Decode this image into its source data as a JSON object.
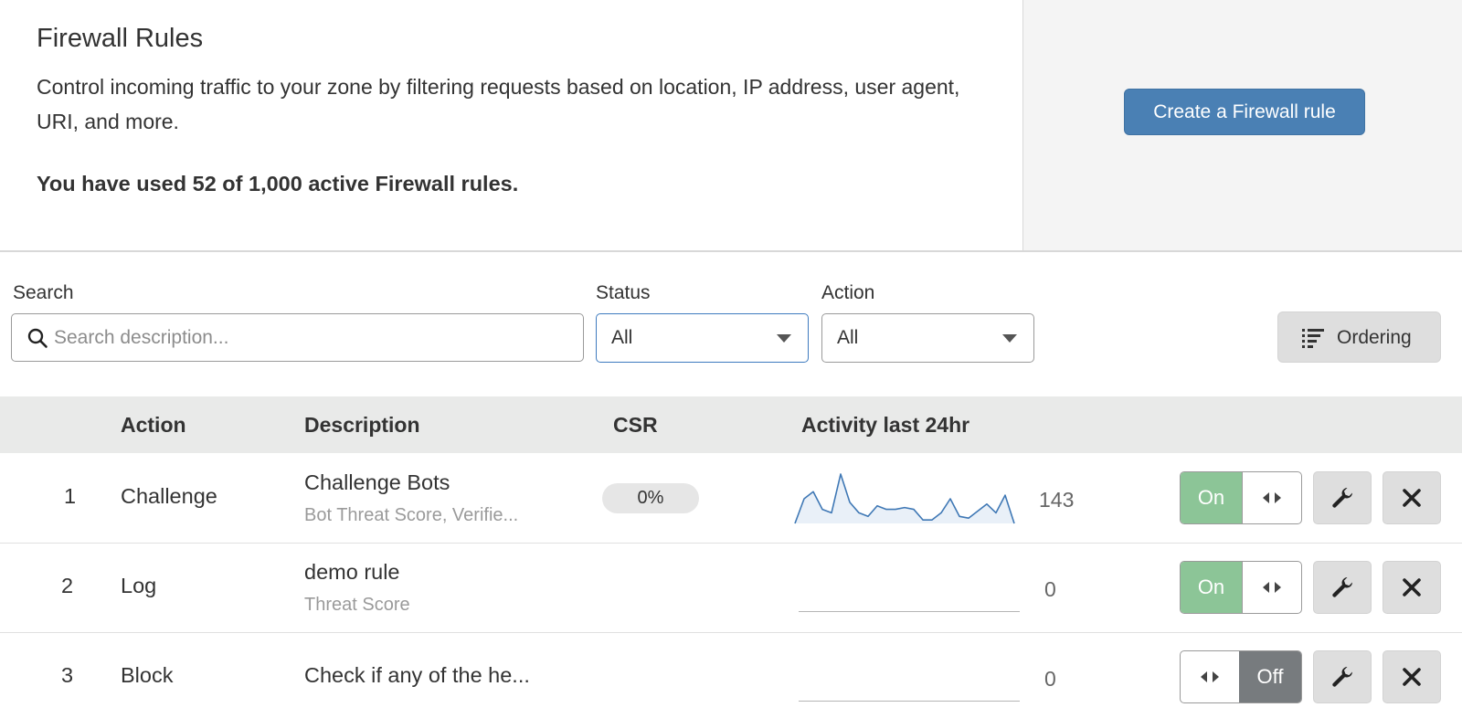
{
  "header": {
    "title": "Firewall Rules",
    "description": "Control incoming traffic to your zone by filtering requests based on location, IP address, user agent, URI, and more.",
    "usage": "You have used 52 of 1,000 active Firewall rules.",
    "create_button": "Create a Firewall rule"
  },
  "filters": {
    "search_label": "Search",
    "search_placeholder": "Search description...",
    "search_value": "",
    "status_label": "Status",
    "status_value": "All",
    "action_label": "Action",
    "action_value": "All",
    "ordering_button": "Ordering"
  },
  "table": {
    "columns": [
      "Action",
      "Description",
      "CSR",
      "Activity last 24hr"
    ],
    "rows": [
      {
        "index": "1",
        "action": "Challenge",
        "description": "Challenge Bots",
        "subtext": "Bot Threat Score, Verifie...",
        "csr": "0%",
        "activity_count": "143",
        "activity": [
          0,
          14,
          18,
          8,
          6,
          28,
          12,
          6,
          4,
          10,
          8,
          8,
          9,
          8,
          2,
          2,
          6,
          14,
          4,
          3,
          7,
          11,
          6,
          16,
          0
        ],
        "status": "On"
      },
      {
        "index": "2",
        "action": "Log",
        "description": "demo rule",
        "subtext": "Threat Score",
        "csr": "",
        "activity_count": "0",
        "activity": [],
        "status": "On"
      },
      {
        "index": "3",
        "action": "Block",
        "description": "Check if any of the he...",
        "subtext": "",
        "csr": "",
        "activity_count": "0",
        "activity": [],
        "status": "Off"
      }
    ]
  },
  "colors": {
    "primary_button": "#4a80b4",
    "toggle_on": "#8cc597",
    "toggle_off": "#777b7e",
    "sparkline": "#3f78b5",
    "sparkline_fill": "#e9f0f8"
  },
  "icons": {
    "search": "search-icon",
    "ordering": "list-icon",
    "toggle_handle": "arrows-horizontal-icon",
    "edit": "wrench-icon",
    "delete": "close-icon"
  }
}
